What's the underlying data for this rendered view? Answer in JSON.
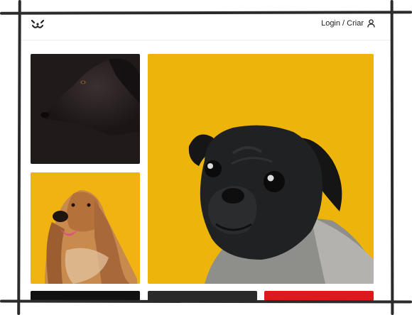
{
  "header": {
    "logo_icon": "dog-face-icon",
    "login_label": "Login / Criar",
    "user_icon": "user-icon"
  },
  "gallery": {
    "images": [
      {
        "subject": "black-dog",
        "background": "#211a1b"
      },
      {
        "subject": "pug",
        "background": "#edb40b"
      },
      {
        "subject": "afghan-hound",
        "background": "#f0b312"
      },
      {
        "subject": "dark-photo",
        "background": "#111111"
      },
      {
        "subject": "gray-photo",
        "background": "#2a2a2a"
      },
      {
        "subject": "red-photo",
        "background": "#e0181a"
      }
    ]
  },
  "colors": {
    "frame": "#2b2b2b",
    "text": "#222222"
  }
}
